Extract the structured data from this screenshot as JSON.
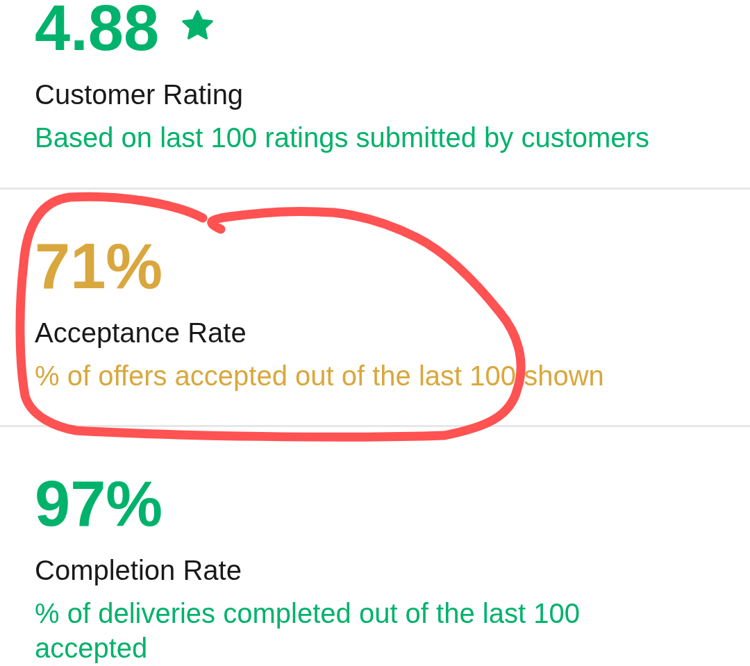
{
  "metrics": [
    {
      "value": "4.88",
      "has_star": true,
      "label": "Customer Rating",
      "description": "Based on last 100 ratings submitted by customers",
      "color": "#00b26b",
      "circled": false
    },
    {
      "value": "71%",
      "has_star": false,
      "label": "Acceptance Rate",
      "description": "% of offers accepted out of the last 100 shown",
      "color": "#d9a73d",
      "circled": true
    },
    {
      "value": "97%",
      "has_star": false,
      "label": "Completion Rate",
      "description": "% of deliveries completed out of the last 100 accepted",
      "color": "#00b26b",
      "circled": false
    }
  ]
}
